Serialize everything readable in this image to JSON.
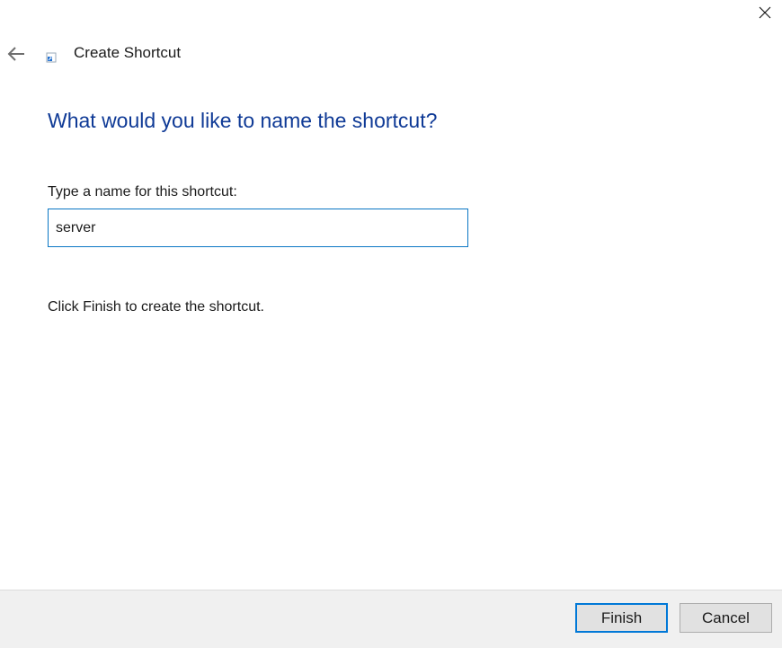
{
  "window": {
    "title": "Create Shortcut",
    "close_icon": "close-icon",
    "back_icon": "back-arrow-icon",
    "app_icon": "shortcut-icon"
  },
  "main": {
    "heading": "What would you like to name the shortcut?",
    "field_label": "Type a name for this shortcut:",
    "name_value": "server",
    "hint": "Click Finish to create the shortcut."
  },
  "footer": {
    "finish_label": "Finish",
    "cancel_label": "Cancel"
  },
  "colors": {
    "heading": "#0f3a96",
    "accent": "#0078d7",
    "footer_bg": "#f0f0f0"
  }
}
